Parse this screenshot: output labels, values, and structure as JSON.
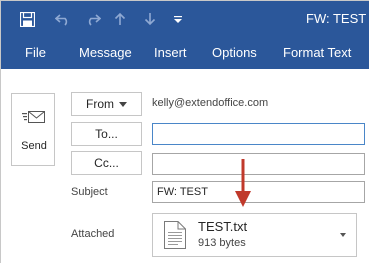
{
  "window": {
    "title": "FW: TEST -"
  },
  "quick_access": {
    "icons": [
      "save-icon",
      "undo-icon",
      "redo-icon",
      "up-arrow-icon",
      "down-arrow-icon",
      "customize-dropdown-icon"
    ]
  },
  "ribbon": {
    "tabs": [
      "File",
      "Message",
      "Insert",
      "Options",
      "Format Text"
    ]
  },
  "compose": {
    "send_label": "Send",
    "from_label": "From",
    "from_value": "kelly@extendoffice.com",
    "to_label": "To...",
    "to_value": "",
    "cc_label": "Cc...",
    "cc_value": "",
    "subject_label": "Subject",
    "subject_value": "FW: TEST",
    "attached_label": "Attached",
    "attachment": {
      "name": "TEST.txt",
      "size": "913 bytes"
    }
  },
  "colors": {
    "ribbon_bg": "#2b579a",
    "annotation_arrow": "#c0392b"
  }
}
